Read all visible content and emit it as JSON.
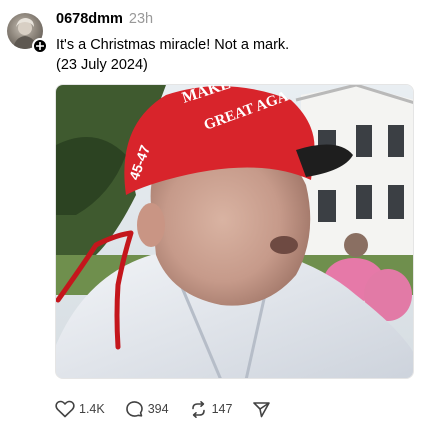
{
  "post": {
    "username": "0678dmm",
    "timestamp": "23h",
    "text_line1": "It's a Christmas miracle! Not a mark.",
    "text_line2": "(23 July 2024)",
    "image": {
      "cap_text_top": "MAKE",
      "cap_text_bottom": "GREAT AGA",
      "cap_side_text": "45-47",
      "cap_color": "#d8242b",
      "annotation_color": "#c4161c"
    },
    "actions": {
      "likes": "1.4K",
      "replies": "394",
      "reposts": "147"
    },
    "icons": {
      "follow": "plus-icon",
      "like": "heart-icon",
      "reply": "speech-bubble-icon",
      "repost": "repost-icon",
      "share": "send-icon"
    }
  }
}
